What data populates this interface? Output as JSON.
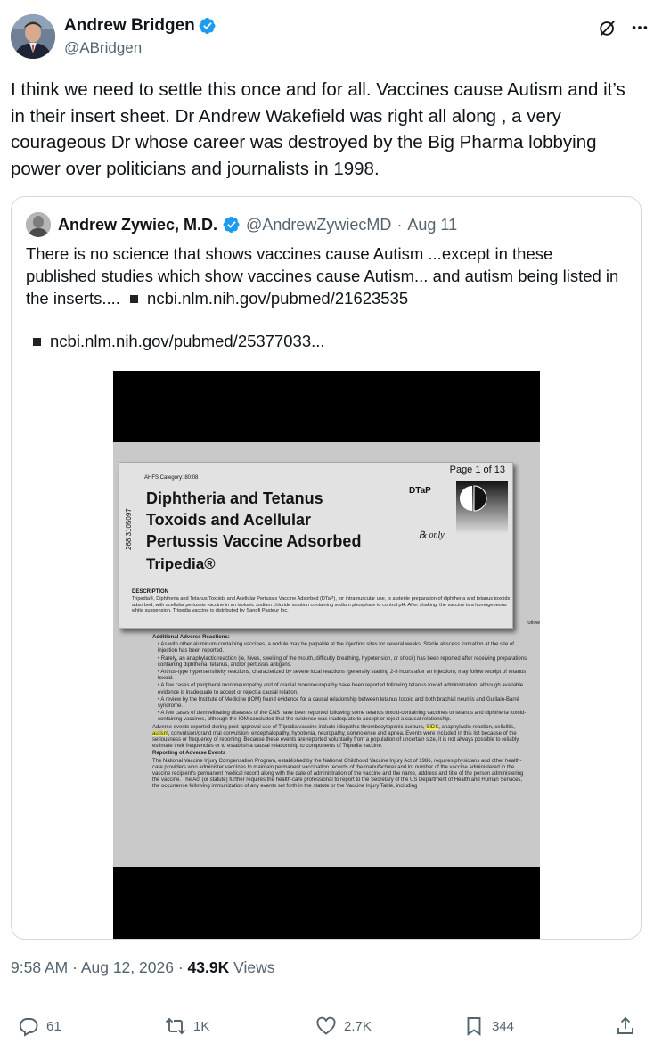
{
  "author": {
    "display_name": "Andrew Bridgen",
    "handle": "@ABridgen",
    "verified": true
  },
  "header_icons": [
    "grok-icon",
    "more-icon"
  ],
  "tweet": {
    "text": "I think we need to settle this once and for all.  Vaccines cause Autism and it’s in their insert sheet. Dr Andrew Wakefield was right all along , a very courageous Dr whose career was destroyed by the Big Pharma lobbying power over politicians and journalists in 1998."
  },
  "quote": {
    "display_name": "Andrew Zywiec, M.D.",
    "handle": "@AndrewZywiecMD",
    "dot": "·",
    "date": "Aug 11",
    "text": "There is no science that shows vaccines cause Autism ...except in these published studies which show vaccines cause Autism... and autism being listed in the inserts....",
    "link1": "ncbi.nlm.nih.gov/pubmed/21623535",
    "link2": "ncbi.nlm.nih.gov/pubmed/25377033...",
    "document": {
      "page_number": "Page 1 of 13",
      "ahfs": "AHFS Category: 80:08",
      "barcode": "268 3105097",
      "title_line1": "Diphtheria and Tetanus",
      "title_line2": "Toxoids and Acellular",
      "title_line3": "Pertussis Vaccine Adsorbed",
      "brand": "Tripedia®",
      "dtap": "DTaP",
      "rx": "℞ only",
      "desc_heading": "DESCRIPTION",
      "desc_text": "Tripedia®, Diphtheria and Tetanus Toxoids and Acellular Pertussis Vaccine Adsorbed (DTaP), for intramuscular use, is a sterile preparation of diphtheria and tetanus toxoids adsorbed, with acellular pertussis vaccine in an isotonic sodium chloride solution containing sodium phosphate to control pH. After shaking, the vaccine is a homogeneous white suspension. Tripedia vaccine is distributed by Sanofi Pasteur Inc.",
      "follow": "follow",
      "additional_heading": "Additional Adverse Reactions:",
      "bullets": [
        "• As with other aluminum-containing vaccines, a nodule may be palpable at the injection sites for several weeks. Sterile abscess formation at the site of injection has been reported.",
        "• Rarely, an anaphylactic reaction (ie, hives, swelling of the mouth, difficulty breathing, hypotension, or shock) has been reported after receiving preparations containing diphtheria, tetanus, and/or pertussis antigens.",
        "• Arthus-type hypersensitivity reactions, characterized by severe local reactions (generally starting 2-8 hours after an injection), may follow receipt of tetanus toxoid.",
        "• A few cases of peripheral mononeuropathy and of cranial mononeuropathy have been reported following tetanus toxoid administration, although available evidence is inadequate to accept or reject a causal relation.",
        "• A review by the Institute of Medicine (IOM) found evidence for a causal relationship between tetanus toxoid and both brachial neuritis and Guillain-Barré syndrome.",
        "• A few cases of demyelinating diseases of the CNS have been reported following some tetanus toxoid-containing vaccines or tetanus and diphtheria toxoid-containing vaccines, although the IOM concluded that the evidence was inadequate to accept or reject a causal relationship."
      ],
      "postapproval_pre": "Adverse events reported during post-approval use of Tripedia vaccine include idiopathic thrombocytopenic purpura, ",
      "sids": "SIDS",
      "postapproval_mid": ", anaphylactic reaction, cellulitis, ",
      "autism": "autism",
      "postapproval_post": ", convulsion/grand mal convulsion, encephalopathy, hypotonia, neuropathy, somnolence and apnea. Events were included in this list because of the seriousness or frequency of reporting. Because these events are reported voluntarily from a population of uncertain size, it is not always possible to reliably estimate their frequencies or to establish a causal relationship to components of Tripedia vaccine.",
      "reporting_heading": "Reporting of Adverse Events",
      "reporting_text": "The National Vaccine Injury Compensation Program, established by the National Childhood Vaccine Injury Act of 1986, requires physicians and other health-care providers who administer vaccines to maintain permanent vaccination records of the manufacturer and lot number of the vaccine administered in the vaccine recipient's permanent medical record along with the date of administration of the vaccine and the name, address and title of the person administering the vaccine. The Act (or statute) further requires the health-care professional to report to the Secretary of the US Department of Health and Human Services, the occurrence following immunization of any events set forth in the statute or the Vaccine Injury Table, including"
    }
  },
  "meta": {
    "time": "9:58 AM",
    "sep1": "·",
    "date": "Aug 12, 2026",
    "sep2": "·",
    "views_count": "43.9K",
    "views_label": "Views"
  },
  "actions": {
    "replies": "61",
    "reposts": "1K",
    "likes": "2.7K",
    "bookmarks": "344"
  },
  "colors": {
    "text": "#0f1419",
    "secondary": "#536471",
    "verified": "#1d9bf0",
    "border": "#cfd9de",
    "highlight": "#ecef5b"
  }
}
